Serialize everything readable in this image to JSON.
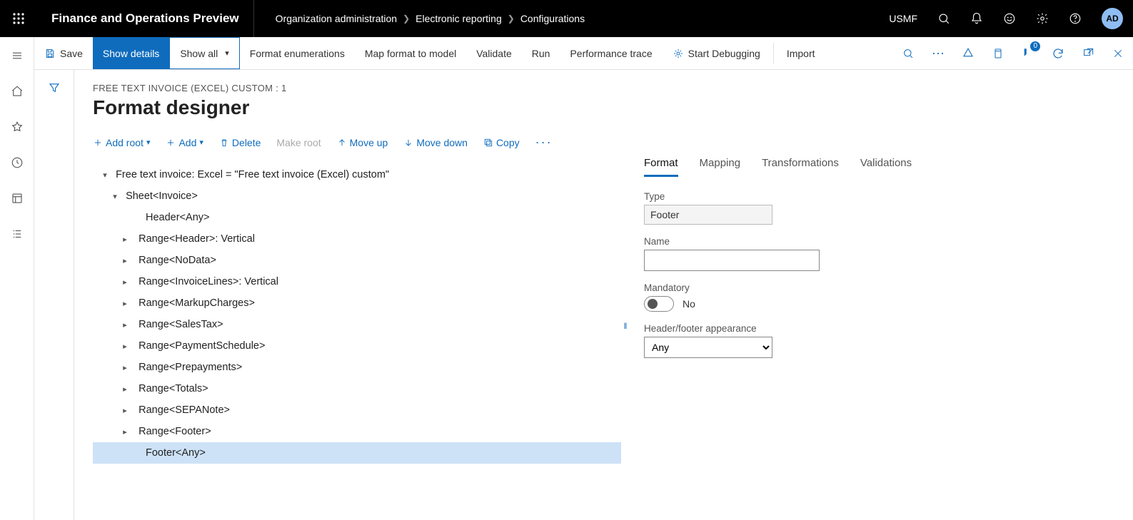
{
  "topbar": {
    "app_title": "Finance and Operations Preview",
    "breadcrumb": [
      "Organization administration",
      "Electronic reporting",
      "Configurations"
    ],
    "entity": "USMF",
    "avatar": "AD"
  },
  "actionbar": {
    "save": "Save",
    "show_details": "Show details",
    "show_all": "Show all",
    "format_enum": "Format enumerations",
    "map_format": "Map format to model",
    "validate": "Validate",
    "run": "Run",
    "perf": "Performance trace",
    "start_debug": "Start Debugging",
    "import": "Import",
    "badge": "0"
  },
  "page": {
    "crumb": "FREE TEXT INVOICE (EXCEL) CUSTOM : 1",
    "title": "Format designer"
  },
  "tree_actions": {
    "add_root": "Add root",
    "add": "Add",
    "delete": "Delete",
    "make_root": "Make root",
    "move_up": "Move up",
    "move_down": "Move down",
    "copy": "Copy"
  },
  "tree": {
    "root": "Free text invoice: Excel = \"Free text invoice (Excel) custom\"",
    "sheet": "Sheet<Invoice>",
    "items": [
      "Header<Any>",
      "Range<Header>: Vertical",
      "Range<NoData>",
      "Range<InvoiceLines>: Vertical",
      "Range<MarkupCharges>",
      "Range<SalesTax>",
      "Range<PaymentSchedule>",
      "Range<Prepayments>",
      "Range<Totals>",
      "Range<SEPANote>",
      "Range<Footer>",
      "Footer<Any>"
    ],
    "selected_index": 11
  },
  "tabs": {
    "format": "Format",
    "mapping": "Mapping",
    "transformations": "Transformations",
    "validations": "Validations"
  },
  "props": {
    "type_label": "Type",
    "type_value": "Footer",
    "name_label": "Name",
    "name_value": "",
    "mandatory_label": "Mandatory",
    "mandatory_value": "No",
    "hf_label": "Header/footer appearance",
    "hf_value": "Any"
  }
}
